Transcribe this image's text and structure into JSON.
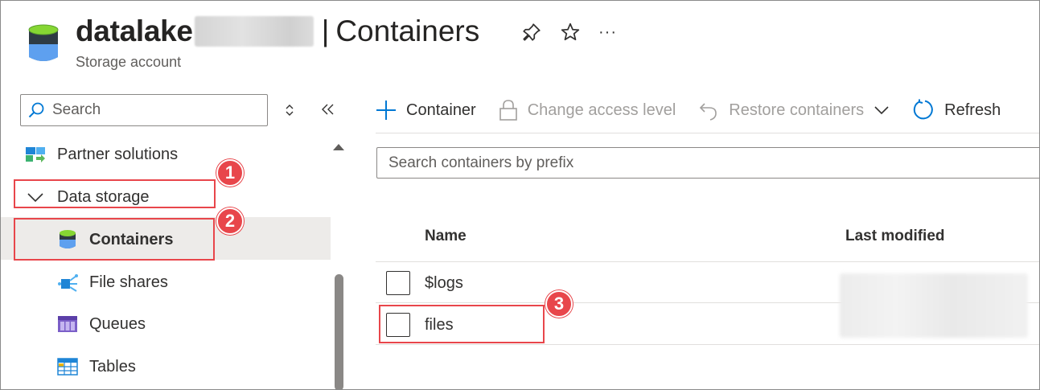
{
  "header": {
    "resource_name": "datalake",
    "separator": "|",
    "page_title": "Containers",
    "subtitle": "Storage account",
    "more_label": "···"
  },
  "nav": {
    "search_placeholder": "Search",
    "items": [
      {
        "label": "Partner solutions",
        "icon": "partner-solutions-icon"
      },
      {
        "label": "Data storage",
        "icon": "chevron-down-icon"
      },
      {
        "label": "Containers",
        "icon": "container-icon",
        "selected": true
      },
      {
        "label": "File shares",
        "icon": "file-share-icon"
      },
      {
        "label": "Queues",
        "icon": "queue-icon"
      },
      {
        "label": "Tables",
        "icon": "table-icon"
      }
    ]
  },
  "toolbar": {
    "container_label": "Container",
    "change_access_label": "Change access level",
    "restore_label": "Restore containers",
    "refresh_label": "Refresh"
  },
  "main": {
    "search_placeholder": "Search containers by prefix",
    "columns": [
      "Name",
      "Last modified"
    ],
    "rows": [
      {
        "name": "$logs"
      },
      {
        "name": "files"
      }
    ]
  },
  "callouts": [
    "1",
    "2",
    "3"
  ],
  "colors": {
    "accent": "#0078d4",
    "callout": "#e8464b",
    "selected_bg": "#edebe9"
  }
}
